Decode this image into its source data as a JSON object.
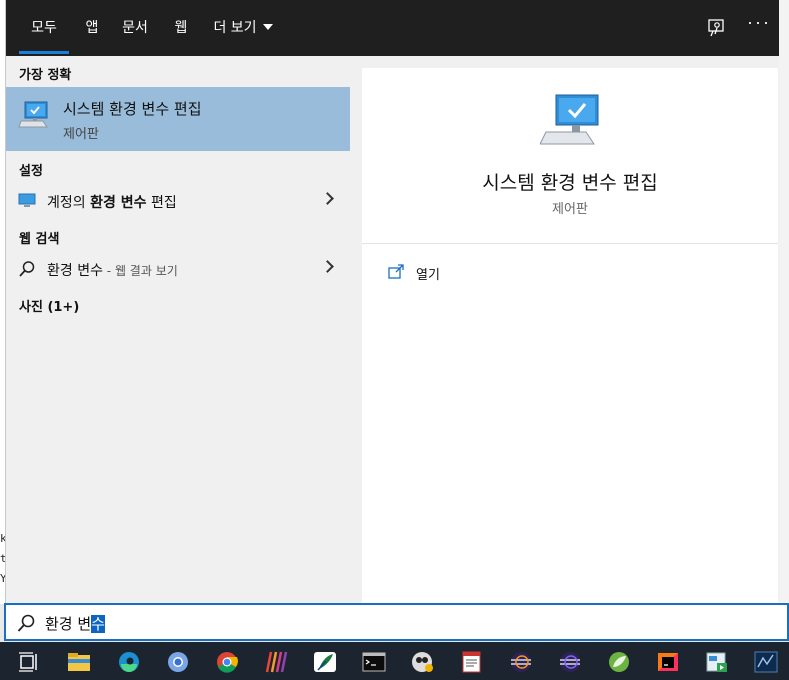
{
  "tabs": [
    {
      "label": "모두",
      "active": true
    },
    {
      "label": "앱"
    },
    {
      "label": "문서"
    },
    {
      "label": "웹"
    },
    {
      "label": "더 보기"
    }
  ],
  "topbar_icons": [
    "feedback-icon",
    "more-icon"
  ],
  "more_label": "···",
  "sections": {
    "best_match": "가장 정확",
    "settings": "설정",
    "web_search": "웹 검색",
    "photos": "사진 (1+)"
  },
  "best_match_item": {
    "title": "시스템 환경 변수 편집",
    "subtitle": "제어판",
    "icon": "system-monitor-icon"
  },
  "settings_item": {
    "prefix": "계정의 ",
    "bold": "환경 변수",
    "suffix": " 편집",
    "icon": "monitor-icon"
  },
  "web_item": {
    "query": "환경 변수",
    "suffix": " - 웹 결과 보기",
    "icon": "search-icon"
  },
  "detail": {
    "title": "시스템 환경 변수 편집",
    "subtitle": "제어판",
    "actions": [
      {
        "label": "열기",
        "icon": "open-icon"
      }
    ]
  },
  "search": {
    "value_plain": "환경 변",
    "value_selected": "수"
  },
  "taskbar": [
    "task-view-icon",
    "file-explorer-icon",
    "edge-icon",
    "chromium-icon",
    "chrome-icon",
    "app-stripes-icon",
    "feather-app-icon",
    "terminal-icon",
    "media-app-icon",
    "notepad-icon",
    "eclipse-icon",
    "eclipse-alt-icon",
    "spring-icon",
    "intellij-icon",
    "app-window-icon",
    "graph-app-icon"
  ],
  "background_chars": [
    "k",
    "t",
    "Y"
  ]
}
